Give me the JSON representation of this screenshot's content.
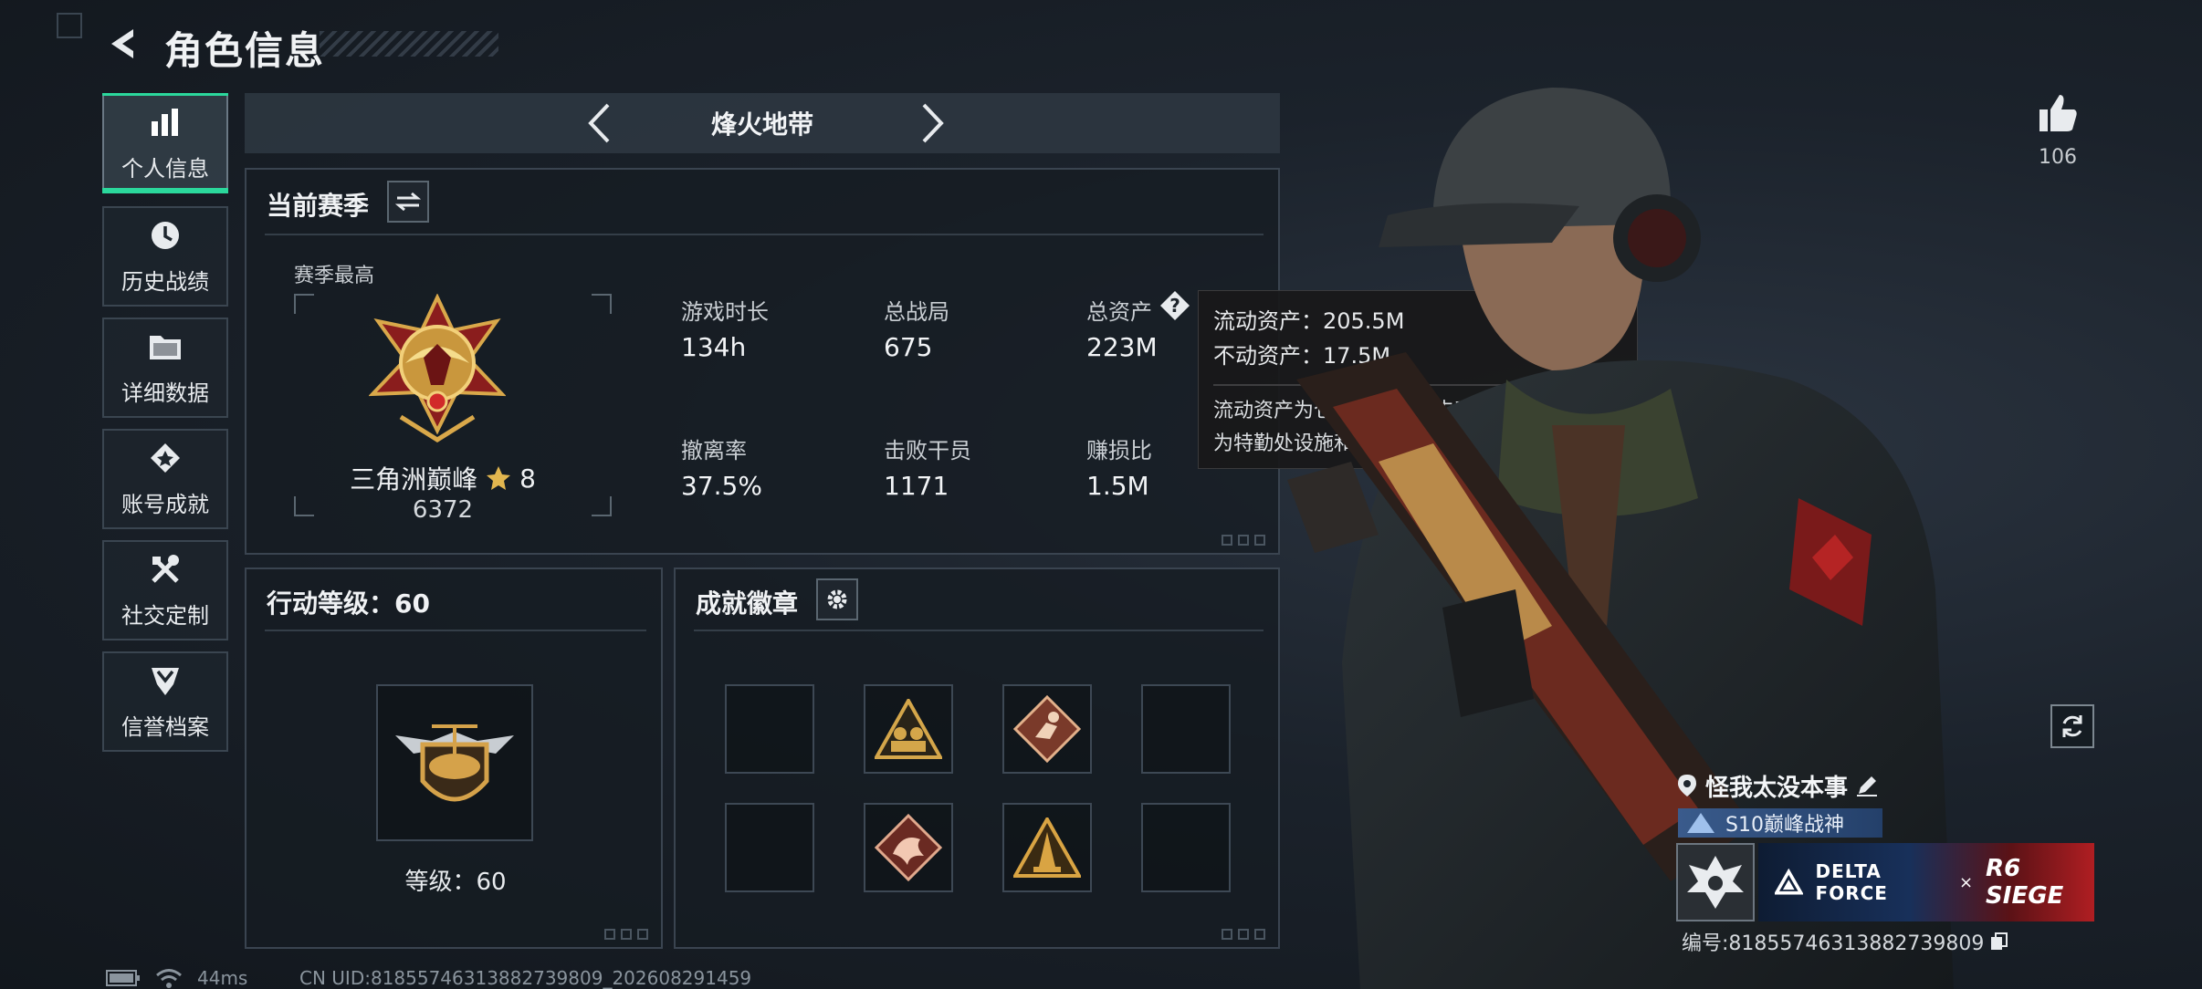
{
  "header": {
    "title": "角色信息"
  },
  "nav": {
    "items": [
      {
        "label": "个人信息",
        "icon": "bar-chart-icon",
        "active": true
      },
      {
        "label": "历史战绩",
        "icon": "history-clock-icon",
        "active": false
      },
      {
        "label": "详细数据",
        "icon": "folder-icon",
        "active": false
      },
      {
        "label": "账号成就",
        "icon": "achievement-icon",
        "active": false
      },
      {
        "label": "社交定制",
        "icon": "tools-icon",
        "active": false
      },
      {
        "label": "信誉档案",
        "icon": "shield-icon",
        "active": false
      }
    ]
  },
  "map_selector": {
    "name": "烽火地带"
  },
  "season": {
    "title": "当前赛季",
    "rank_caption": "赛季最高",
    "rank_name": "三角洲巅峰",
    "rank_stars": "8",
    "rank_points": "6372",
    "stats": [
      {
        "label": "游戏时长",
        "value": "134h"
      },
      {
        "label": "总战局",
        "value": "675"
      },
      {
        "label": "总资产",
        "value": "223M"
      },
      {
        "label": "撤离率",
        "value": "37.5%"
      },
      {
        "label": "击败干员",
        "value": "1171"
      },
      {
        "label": "赚损比",
        "value": "1.5M"
      }
    ]
  },
  "tooltip": {
    "liquid": "流动资产：205.5M",
    "fixed": "不动资产：17.5M",
    "desc_line1": "流动资产为仓库资产和哈夫币，不动资产",
    "desc_line2": "为特勤处设施和收藏室设施"
  },
  "action_level": {
    "title": "行动等级：60",
    "level_text": "等级：60"
  },
  "badges": {
    "title": "成就徽章",
    "slots": [
      {
        "filled": false
      },
      {
        "filled": true,
        "icon": "squad-badge-icon"
      },
      {
        "filled": true,
        "icon": "runner-badge-icon"
      },
      {
        "filled": false
      },
      {
        "filled": false
      },
      {
        "filled": true,
        "icon": "dragon-badge-icon"
      },
      {
        "filled": true,
        "icon": "tower-badge-icon"
      },
      {
        "filled": false
      }
    ]
  },
  "social": {
    "likes": "106"
  },
  "player": {
    "name": "怪我太没本事",
    "title_tag": "S10巅峰战神",
    "banner_brand": "DELTA FORCE",
    "banner_x": "×",
    "banner_collab": "R6 SIEGE",
    "id_text": "编号:8185574631388273980​9"
  },
  "status": {
    "ping": "44ms",
    "uid": "CN UID:81855746313882739809_202608291459"
  },
  "colors": {
    "accent": "#2bd89c",
    "panel_border": "#3a4450",
    "tooltip_bg": "#18181a"
  }
}
